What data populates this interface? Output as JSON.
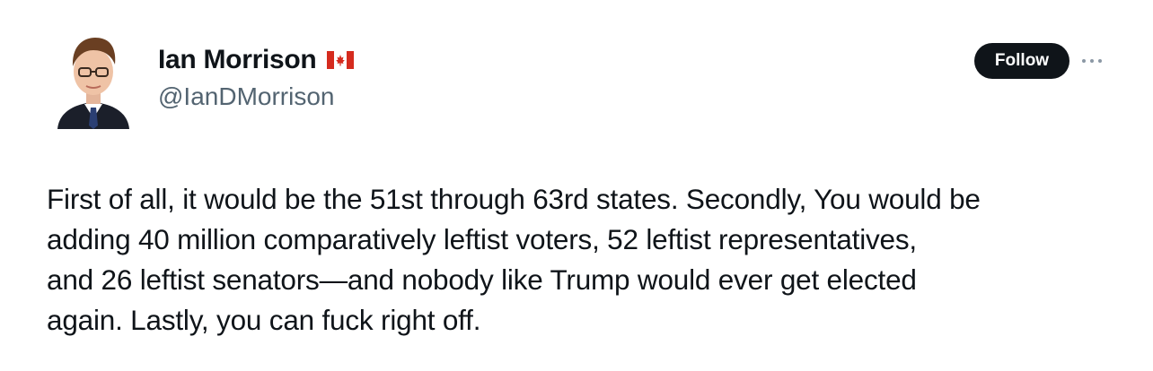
{
  "author": {
    "display_name": "Ian Morrison",
    "handle": "@IanDMorrison",
    "flag_icon": "canada-flag-icon",
    "avatar_icon": "avatar"
  },
  "actions": {
    "follow_label": "Follow",
    "more_icon": "more-horizontal-icon"
  },
  "tweet": {
    "text": "First of all, it would be the 51st through 63rd states. Secondly, You would be\nadding 40 million comparatively leftist voters, 52 leftist representatives,\nand 26 leftist senators—and nobody like Trump would ever get elected\nagain. Lastly, you can fuck right off."
  },
  "colors": {
    "text_primary": "#0f1419",
    "text_secondary": "#536471",
    "follow_bg": "#0f1419",
    "flag_red": "#d52b1e"
  }
}
